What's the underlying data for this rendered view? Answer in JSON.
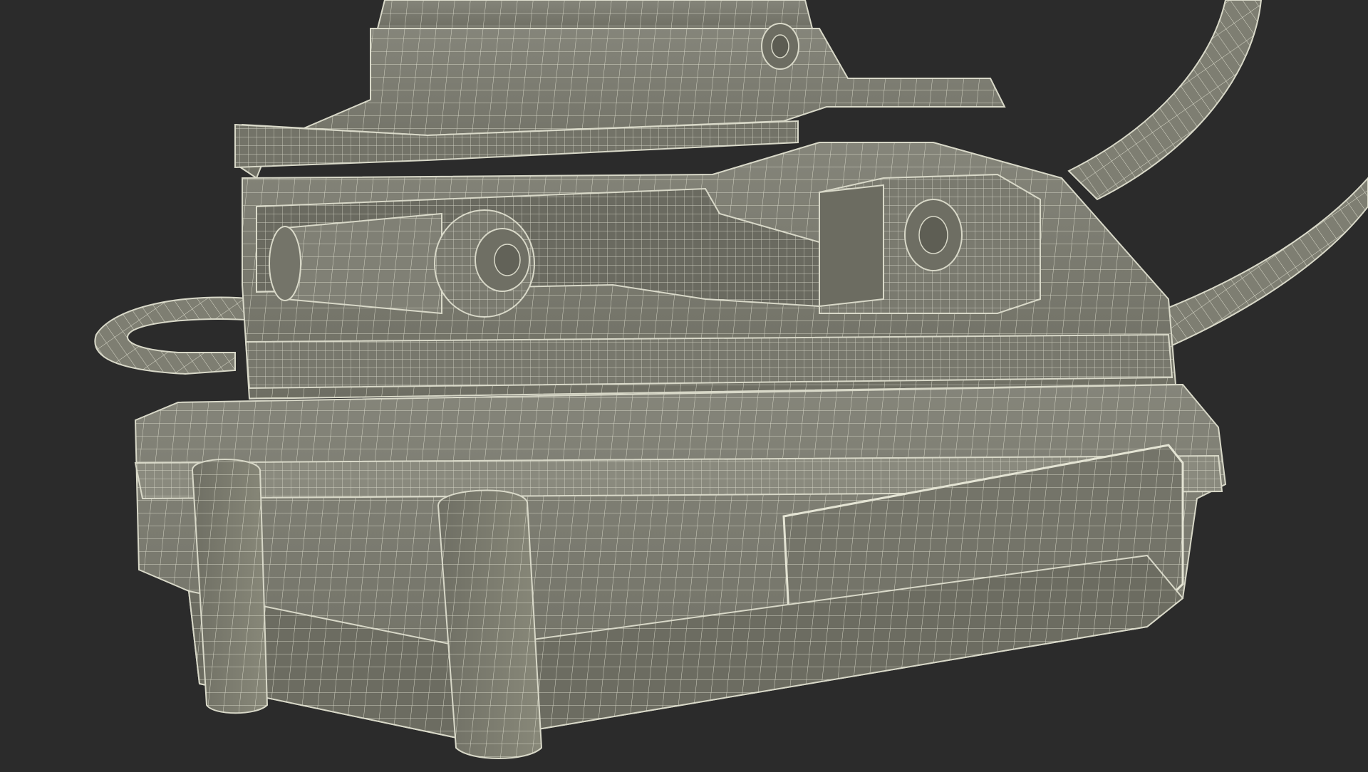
{
  "scene": {
    "subject": "wireframe-mesh-render",
    "colors": {
      "background": "#2b2b2b",
      "surface": "#7e7e72",
      "surface_dark": "#6d6d62",
      "surface_light": "#8e8e82",
      "wire": "#e4e4d4",
      "outline": "#d8d8c8"
    },
    "icons": [
      "knob-icon",
      "bolt-icon",
      "cable-icon"
    ]
  }
}
